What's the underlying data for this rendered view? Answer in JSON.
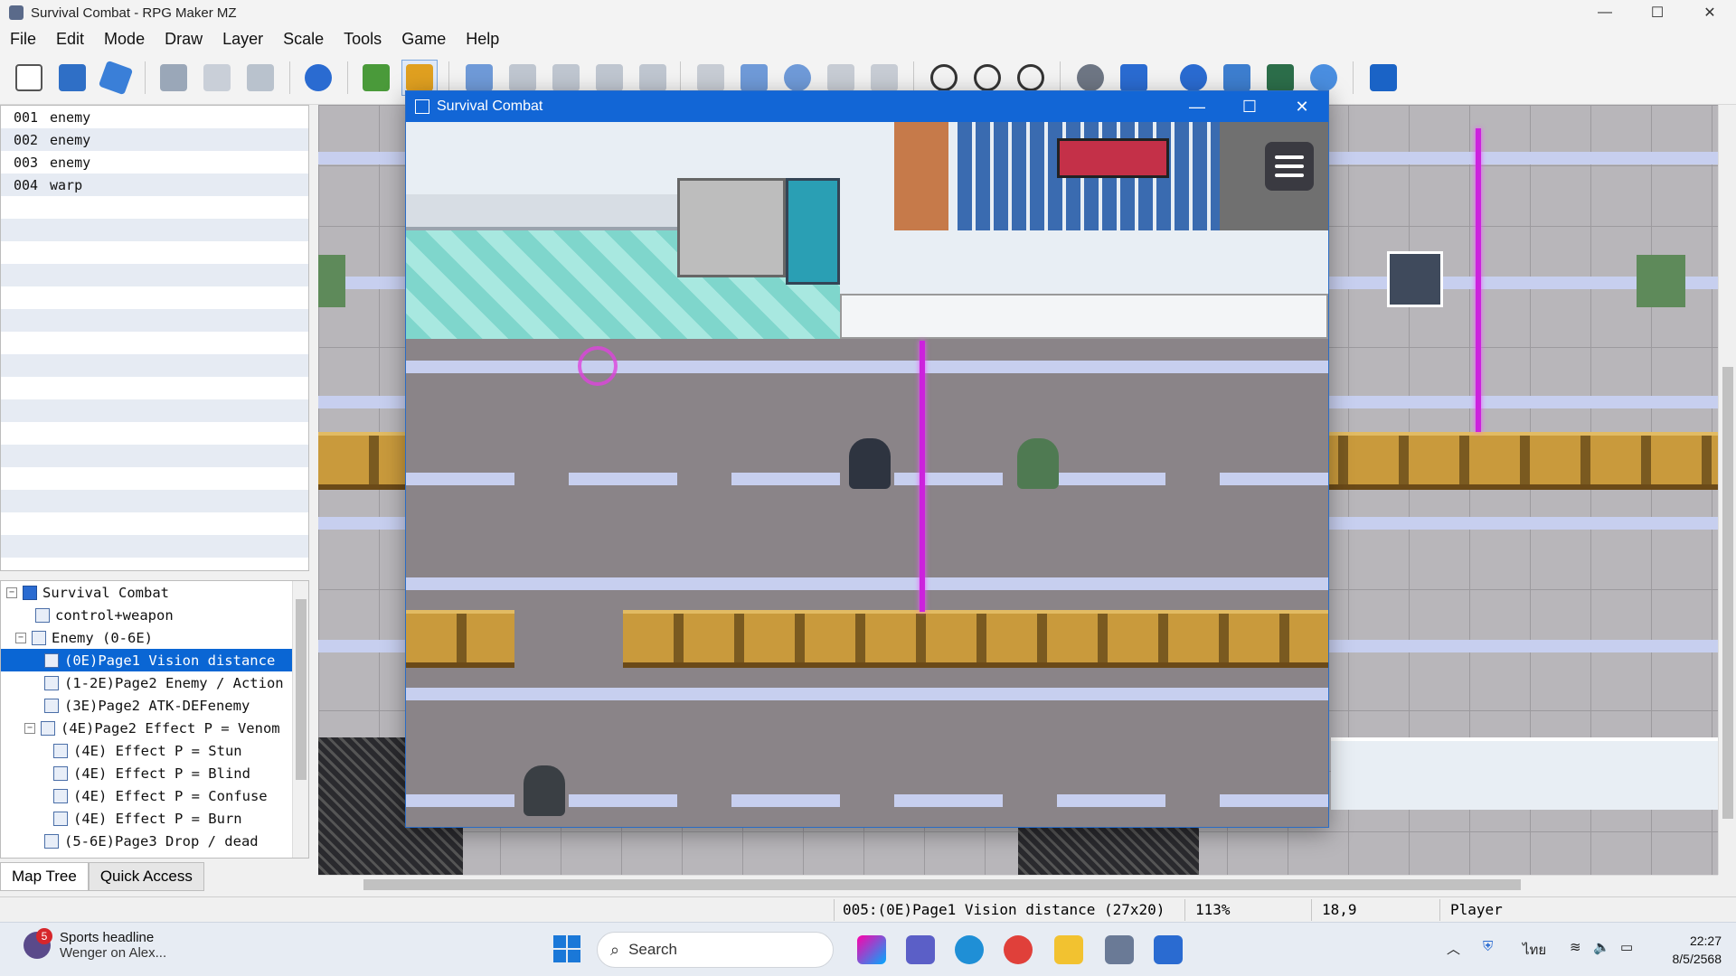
{
  "window": {
    "title": "Survival Combat - RPG Maker MZ",
    "minimize": "—",
    "maximize": "☐",
    "close": "✕"
  },
  "menu": [
    "File",
    "Edit",
    "Mode",
    "Draw",
    "Layer",
    "Scale",
    "Tools",
    "Game",
    "Help"
  ],
  "events": [
    {
      "num": "001",
      "name": "enemy"
    },
    {
      "num": "002",
      "name": "enemy"
    },
    {
      "num": "003",
      "name": "enemy"
    },
    {
      "num": "004",
      "name": "warp"
    }
  ],
  "tree": [
    {
      "label": "Survival Combat",
      "toggle": "⊟"
    },
    {
      "label": "control+weapon"
    },
    {
      "label": "Enemy (0-6E)",
      "toggle": "⊟"
    },
    {
      "label": "(0E)Page1 Vision distance",
      "selected": true
    },
    {
      "label": "(1-2E)Page2 Enemy / Action"
    },
    {
      "label": "(3E)Page2 ATK-DEFenemy"
    },
    {
      "label": "(4E)Page2 Effect P = Venom",
      "toggle": "⊟"
    },
    {
      "label": "(4E) Effect P = Stun"
    },
    {
      "label": "(4E) Effect P = Blind"
    },
    {
      "label": "(4E) Effect P = Confuse"
    },
    {
      "label": "(4E) Effect P = Burn"
    },
    {
      "label": "(5-6E)Page3 Drop / dead"
    }
  ],
  "tabs": {
    "map_tree": "Map Tree",
    "quick_access": "Quick Access"
  },
  "game_window": {
    "title": "Survival Combat",
    "minimize": "—",
    "maximize": "☐",
    "close": "✕"
  },
  "status": {
    "map": "005:(0E)Page1 Vision distance (27x20)",
    "zoom": "113%",
    "coords": "18,9",
    "mode": "Player"
  },
  "taskbar": {
    "news_badge": "5",
    "news_title": "Sports headline",
    "news_sub": "Wenger on Alex...",
    "search_placeholder": "Search",
    "lang": "ไทย",
    "time": "22:27",
    "date": "8/5/2568"
  },
  "colors": {
    "accent": "#1266d6",
    "laser": "#cc22dd",
    "selection": "#0a66d4"
  }
}
